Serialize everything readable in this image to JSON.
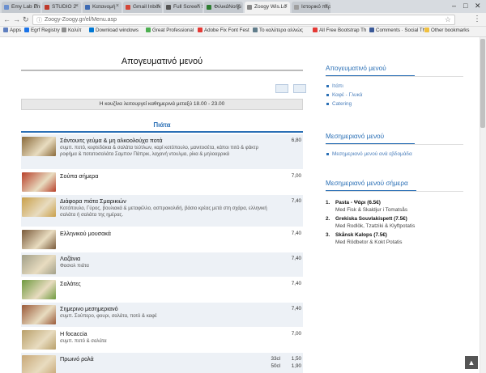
{
  "browser": {
    "tabs": [
      {
        "label": "Emy Lab Ensemble",
        "color": "#6a8fcf"
      },
      {
        "label": "STUDIO 2",
        "color": "#c0392b"
      },
      {
        "label": "Κατανομή",
        "color": "#3d6ab3"
      },
      {
        "label": "Gmail Inbox",
        "color": "#d44638"
      },
      {
        "label": "Full Screen S",
        "color": "#555555"
      },
      {
        "label": "ΦιλικάΝοήμ",
        "color": "#2e7d32"
      },
      {
        "label": "Zoogy Wis.Lo",
        "color": "#888888"
      },
      {
        "label": "Ιστορικό περ",
        "color": "#9e9e9e"
      }
    ],
    "url": "Zoogy-Zoogy.gr/el/Menu.asp",
    "bookmarks": [
      {
        "label": "Apps",
        "color": "#5f7fbf"
      },
      {
        "label": "Egrf Registry",
        "color": "#1a73e8"
      },
      {
        "label": "Καλύτ",
        "color": "#8e8e8e"
      },
      {
        "label": "Download windows",
        "color": "#0078d4"
      },
      {
        "label": "Great Professional",
        "color": "#4caf50"
      },
      {
        "label": "Adobe Fix Font Fest",
        "color": "#e53935"
      },
      {
        "label": "Το καλύτερο αλλιώς",
        "color": "#607d8b"
      },
      {
        "label": "All Free Bootstrap Th",
        "color": "#e53935"
      },
      {
        "label": "Comments · Social Th",
        "color": "#3b5998"
      },
      {
        "label": "Other bookmarks",
        "color": "#f0c040"
      }
    ]
  },
  "page": {
    "title": "Απογευματινό μενού",
    "hours": "Η κουζίνα λειτουργεί καθημερινά μεταξύ 18.00 - 23.00",
    "section_tab": "Πιάτα",
    "items": [
      {
        "name": "Σάντουιτς γεύμα & μη αλκοολούχα ποτά",
        "desc": "συμπ. ποτό, κεφτεδάκια & σαλάτα τεύτλων, καρί κοτόπουλο, μανιτοσέτα, κάποι πιτό & φάκτρ ροφήμα & ποτατοσαλάτα Σαμπον Πάπρικ, λαχανή ντουλμα, ρίκα & μηλοαρρικά",
        "qty": "",
        "price": "6,80",
        "color": "#8a6a3a",
        "height": 44,
        "alt": true
      },
      {
        "name": "Σούπα σήμερα",
        "desc": "",
        "qty": "",
        "price": "7,00",
        "color": "#b8402a",
        "height": 31,
        "alt": false
      },
      {
        "name": "Διάφορα πιάτα Σμαρικιών",
        "desc": "Κοτόπουλο, Γύρος, βουλιακά & μεταφέλλο, ασπρακολιδή, βάσιο κρέας μετά στη σχάρα, ελληνική σαλάτα ή σαλάτα της ημέρας.",
        "qty": "",
        "price": "7,40",
        "color": "#c9a04a",
        "height": 40,
        "alt": true
      },
      {
        "name": "Ελληνικού μουσακά",
        "desc": "",
        "qty": "",
        "price": "7,40",
        "color": "#7a5a3a",
        "height": 31,
        "alt": false
      },
      {
        "name": "Λαζάνια",
        "desc": "Φασιολ πιάτα",
        "qty": "",
        "price": "7,40",
        "color": "#a2a089",
        "height": 31,
        "alt": true
      },
      {
        "name": "Σαλάτες",
        "desc": "",
        "qty": "",
        "price": "7,40",
        "color": "#6f9a3f",
        "height": 31,
        "alt": false
      },
      {
        "name": "Σημερινο μεσημεριανό",
        "desc": "συμπ. Σούπερο, φουρι, σαλάτα, ποτό & καφέ",
        "qty": "",
        "price": "7,40",
        "color": "#9a5a3a",
        "height": 31,
        "alt": true
      },
      {
        "name": "Η focaccia",
        "desc": "συμπ. ποτό & σαλάτα",
        "qty": "",
        "price": "7,00",
        "color": "#b9a06a",
        "height": 31,
        "alt": false
      },
      {
        "name": "Πρωινό ρολά",
        "desc": "",
        "qty": "33cl\n50cl",
        "price": "1,50\n1,90",
        "color": "#c8a878",
        "height": 31,
        "alt": true
      }
    ]
  },
  "sidebar": {
    "menu_title": "Απογευματινό μενού",
    "menu_links": [
      "Ιτάπι",
      "Καφέ - Γλυκά",
      "Catering"
    ],
    "lunch_title": "Μεσημεριανό μενού",
    "lunch_links": [
      "Μεσημεριανό μενού ανά εβδομάδα"
    ],
    "today_title": "Μεσημεριανό μενού σήμερα",
    "today_items": [
      {
        "num": "1.",
        "title": "Pasta - Ψάρι (6.5€)",
        "sub": "Med Fisk & Skaldjur i Tomatsås"
      },
      {
        "num": "2.",
        "title": "Grekiska Souvlakispett (7.5€)",
        "sub": "Med Rodlök, Tzatziki & Klyftpotatis"
      },
      {
        "num": "3.",
        "title": "Skånsk Kalops (7.5€)",
        "sub": "Med Rödbetor & Kokt Potatis"
      }
    ]
  }
}
